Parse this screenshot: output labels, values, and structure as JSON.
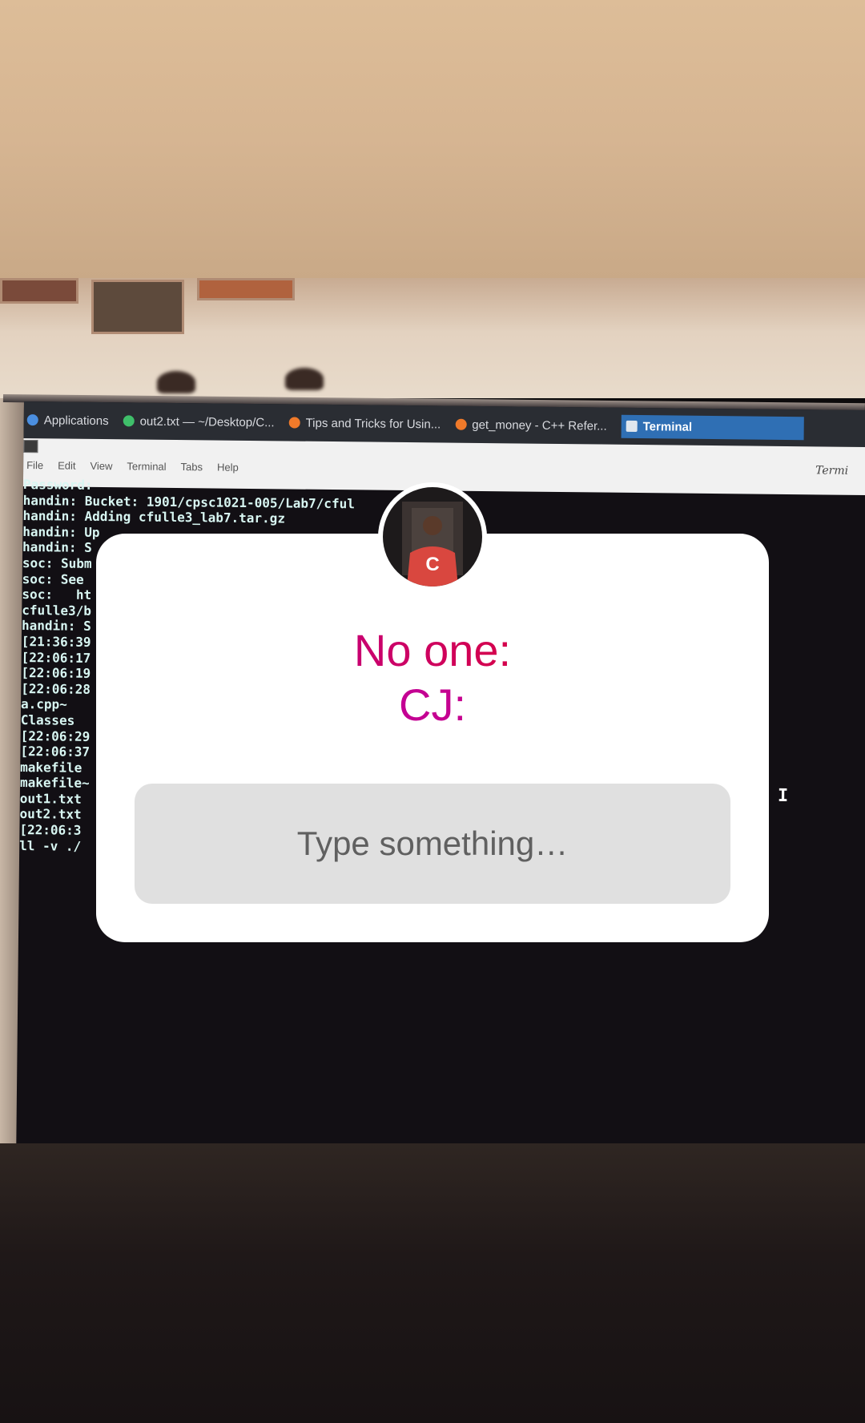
{
  "terminal": {
    "taskbar": {
      "applications_label": "Applications",
      "tab1": "out2.txt — ~/Desktop/C...",
      "tab2": "Tips and Tricks for Usin...",
      "tab3": "get_money - C++ Refer...",
      "tab4": "Terminal"
    },
    "menu": [
      "File",
      "Edit",
      "View",
      "Terminal",
      "Tabs",
      "Help"
    ],
    "window_title_partial": "Termi",
    "lines": [
      "Password:",
      "handin: Bucket: 1901/cpsc1021-005/Lab7/cful",
      "handin: Adding cfulle3_lab7.tar.gz",
      "handin: Up",
      "handin: S",
      "soc: Subm",
      "soc: See",
      "soc:   ht",
      "cfulle3/b",
      "handin: S",
      "[21:36:39",
      "[22:06:17",
      "[22:06:19",
      "[22:06:28",
      "a.cpp~",
      "Classes",
      "[22:06:29",
      "[22:06:37",
      "makefile",
      "makefile~",
      "out1.txt",
      "out2.txt",
      "[22:06:3",
      "ll -v ./"
    ]
  },
  "story_question": {
    "line1": "No one:",
    "line2": "CJ:",
    "answer_placeholder": "Type something…",
    "avatar": "profile-photo",
    "shirt_letter": "C"
  },
  "colors": {
    "gradient_start": "#b300b0",
    "gradient_end": "#e61a1a",
    "card": "#ffffff",
    "answer_bg": "#e0e0e0"
  }
}
